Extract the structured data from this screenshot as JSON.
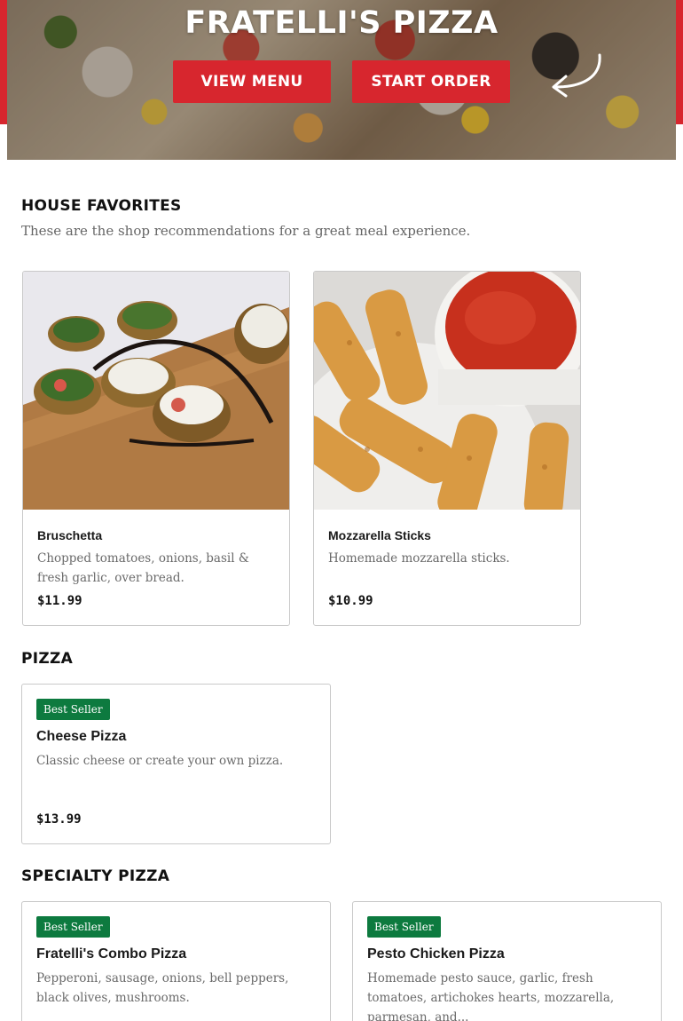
{
  "hero": {
    "title": "FRATELLI'S PIZZA",
    "view_menu_label": "VIEW MENU",
    "start_order_label": "START ORDER",
    "arrow_icon": "curved-arrow-icon"
  },
  "house_favorites": {
    "title": "HOUSE FAVORITES",
    "description": "These are the shop recommendations for a great meal experience.",
    "items": [
      {
        "name": "Bruschetta",
        "description": "Chopped tomatoes, onions, basil & fresh garlic, over bread.",
        "price": "$11.99"
      },
      {
        "name": "Mozzarella Sticks",
        "description": "Homemade mozzarella sticks.",
        "price": "$10.99"
      }
    ]
  },
  "pizza": {
    "title": "PIZZA",
    "items": [
      {
        "badge": "Best Seller",
        "name": "Cheese Pizza",
        "description": "Classic cheese or create your own pizza.",
        "price": "$13.99"
      }
    ]
  },
  "specialty_pizza": {
    "title": "SPECIALTY PIZZA",
    "items": [
      {
        "badge": "Best Seller",
        "name": "Fratelli's Combo Pizza",
        "description": "Pepperoni, sausage, onions, bell peppers, black olives, mushrooms."
      },
      {
        "badge": "Best Seller",
        "name": "Pesto Chicken Pizza",
        "description": "Homemade pesto sauce, garlic, fresh tomatoes, artichokes hearts, mozzarella, parmesan, and..."
      }
    ]
  },
  "colors": {
    "brand_red": "#d7262e",
    "badge_green": "#0d7a3f"
  }
}
